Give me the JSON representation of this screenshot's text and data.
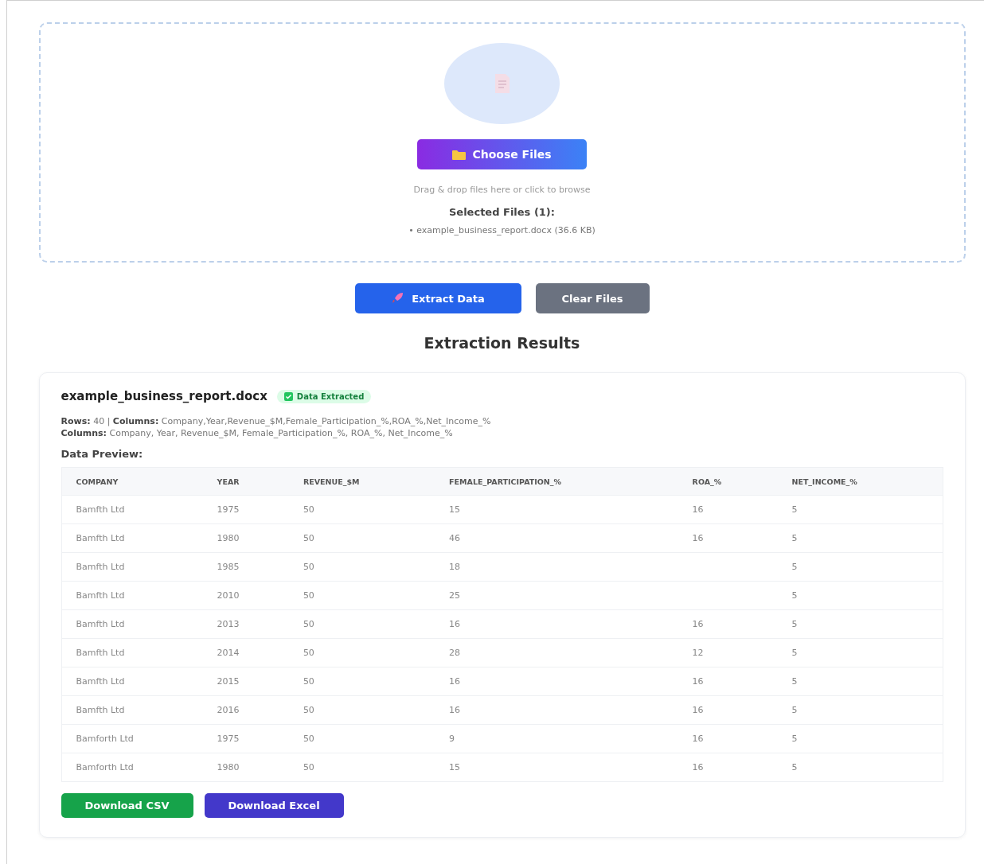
{
  "upload": {
    "choose_button": "Choose Files",
    "hint": "Drag & drop files here or click to browse",
    "selected_title": "Selected Files (1):",
    "files": [
      "• example_business_report.docx (36.6 KB)"
    ]
  },
  "actions": {
    "extract_button": "Extract Data",
    "clear_button": "Clear Files"
  },
  "results_title": "Extraction Results",
  "result": {
    "file_name": "example_business_report.docx",
    "status_badge": "Data Extracted",
    "rows_line": "**Rows:** 40 | **Columns:** Company,Year,Revenue_$M,Female_Participation_%,ROA_%,Net_Income_%",
    "columns_line": "**Columns:** Company, Year, Revenue_$M, Female_Participation_%, ROA_%, Net_Income_%",
    "preview_title": "Data Preview:",
    "table": {
      "columns": [
        "COMPANY",
        "YEAR",
        "REVENUE_$M",
        "FEMALE_PARTICIPATION_%",
        "ROA_%",
        "NET_INCOME_%"
      ],
      "rows": [
        [
          "Bamfth Ltd",
          "1975",
          "50",
          "15",
          "16",
          "5"
        ],
        [
          "Bamfth Ltd",
          "1980",
          "50",
          "46",
          "16",
          "5"
        ],
        [
          "Bamfth Ltd",
          "1985",
          "50",
          "18",
          null,
          "5"
        ],
        [
          "Bamfth Ltd",
          "2010",
          "50",
          "25",
          null,
          "5"
        ],
        [
          "Bamfth Ltd",
          "2013",
          "50",
          "16",
          "16",
          "5"
        ],
        [
          "Bamfth Ltd",
          "2014",
          "50",
          "28",
          "12",
          "5"
        ],
        [
          "Bamfth Ltd",
          "2015",
          "50",
          "16",
          "16",
          "5"
        ],
        [
          "Bamfth Ltd",
          "2016",
          "50",
          "16",
          "16",
          "5"
        ],
        [
          "Bamforth Ltd",
          "1975",
          "50",
          "9",
          "16",
          "5"
        ],
        [
          "Bamforth Ltd",
          "1980",
          "50",
          "15",
          "16",
          "5"
        ]
      ]
    },
    "downloads": [
      "Download CSV",
      "Download Excel"
    ]
  }
}
